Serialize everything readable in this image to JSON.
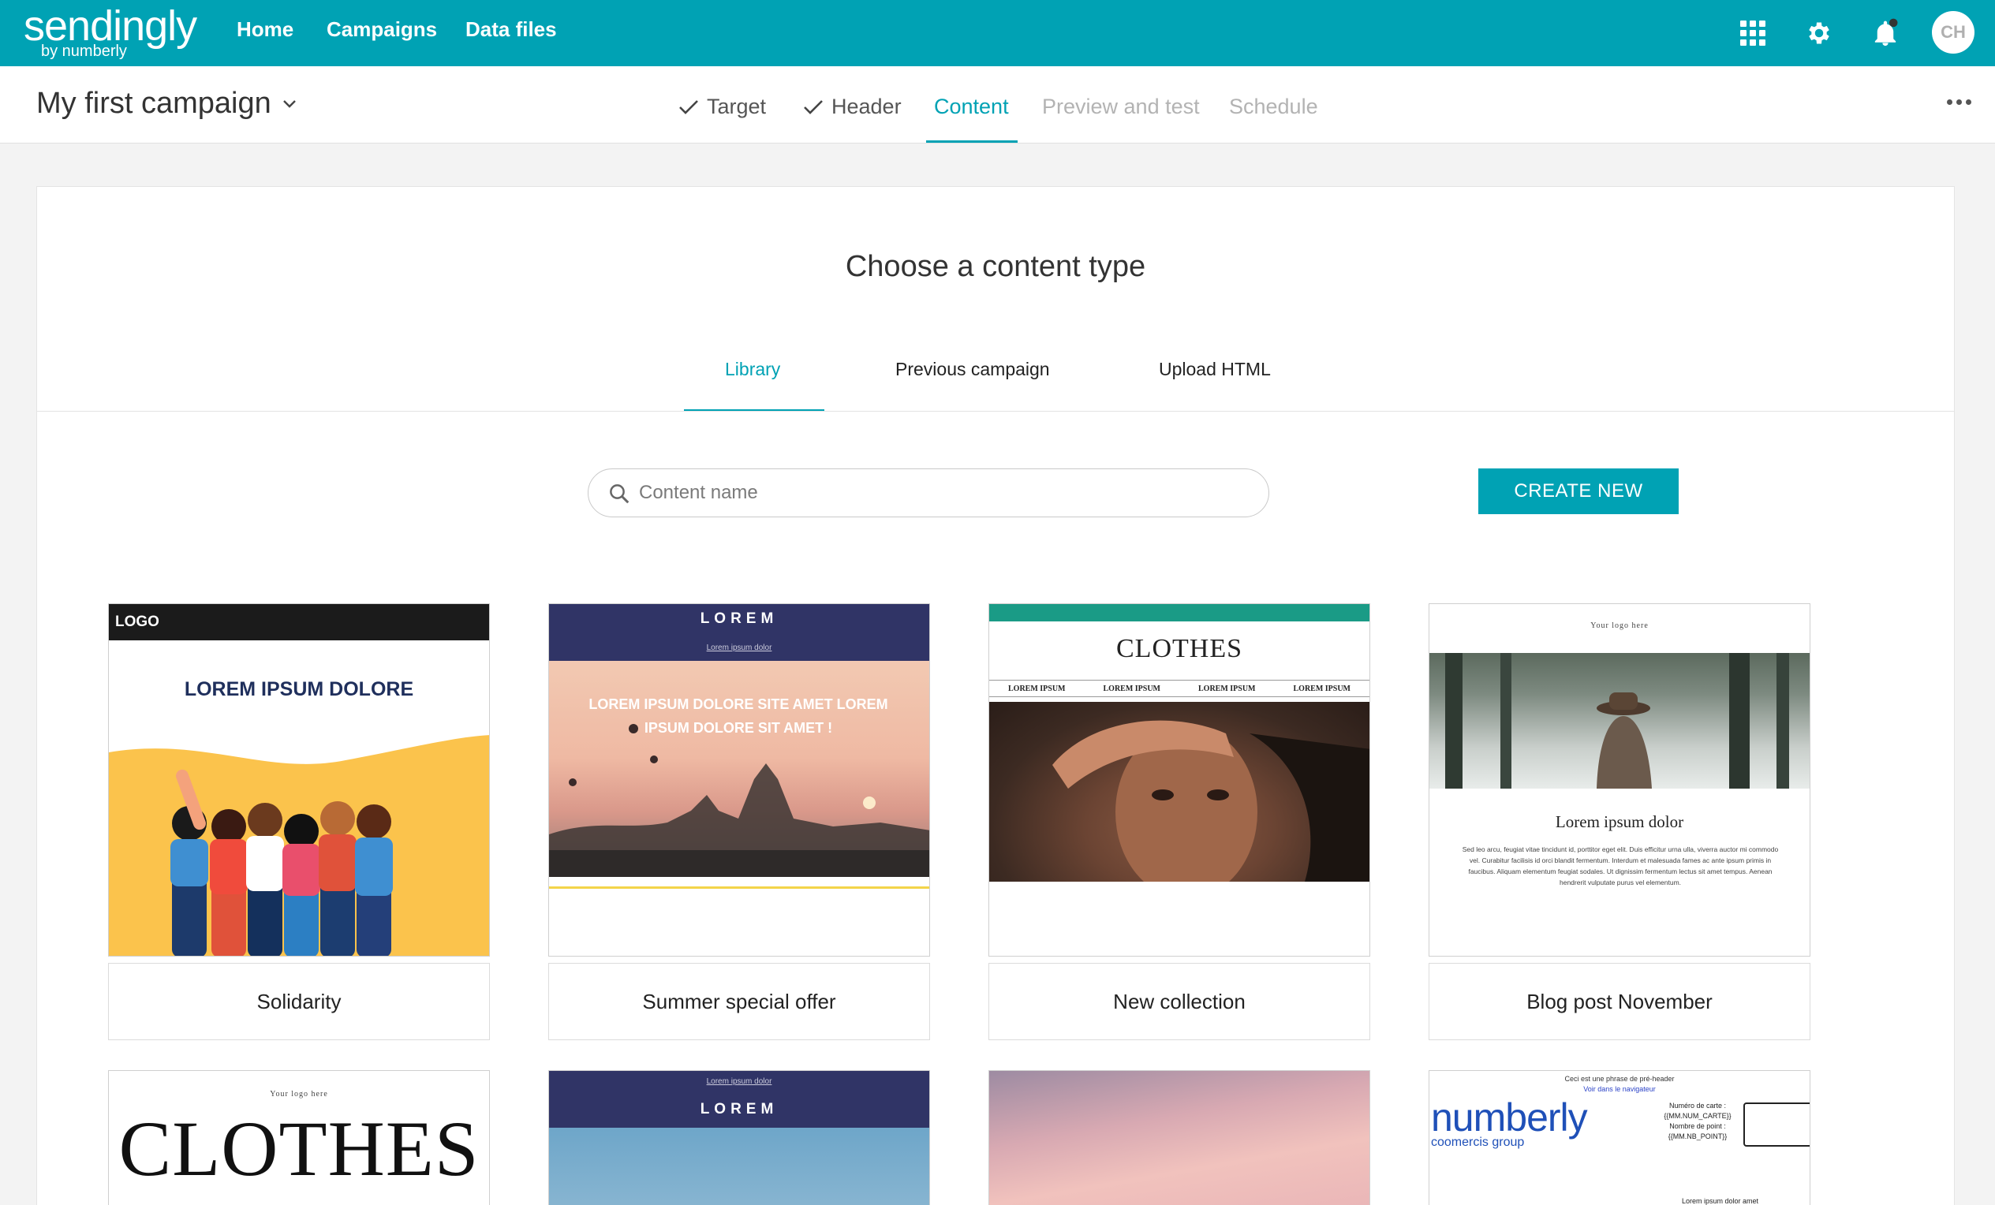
{
  "topnav": {
    "brand": "sendingly",
    "brand_sub": "by numberly",
    "links": [
      "Home",
      "Campaigns",
      "Data files"
    ],
    "avatar_initials": "CH"
  },
  "campaign": {
    "title": "My first campaign",
    "steps": [
      {
        "label": "Target",
        "state": "done"
      },
      {
        "label": "Header",
        "state": "done"
      },
      {
        "label": "Content",
        "state": "active"
      },
      {
        "label": "Preview and test",
        "state": "disabled"
      },
      {
        "label": "Schedule",
        "state": "disabled"
      }
    ]
  },
  "content": {
    "title": "Choose a content type",
    "tabs": [
      "Library",
      "Previous campaign",
      "Upload HTML"
    ],
    "search_placeholder": "Content name",
    "create_label": "CREATE NEW"
  },
  "templates": [
    {
      "name": "Solidarity",
      "logo": "LOGO",
      "headline": "LOREM IPSUM DOLORE"
    },
    {
      "name": "Summer special offer",
      "brand": "LOREM",
      "sub": "Lorem ipsum dolor",
      "headline": "LOREM IPSUM DOLORE SITE AMET LOREM IPSUM DOLORE SIT AMET !"
    },
    {
      "name": "New collection",
      "brand": "CLOTHES",
      "nav": [
        "LOREM IPSUM",
        "LOREM IPSUM",
        "LOREM IPSUM",
        "LOREM IPSUM"
      ]
    },
    {
      "name": "Blog post November",
      "logo": "Your logo here",
      "headline": "Lorem ipsum dolor",
      "body": "Sed leo arcu, feugiat vitae tincidunt id, porttitor eget elit. Duis efficitur urna ulla, viverra auctor mi commodo vel. Curabitur facilisis id orci blandit fermentum. Interdum et malesuada fames ac ante ipsum primis in faucibus. Aliquam elementum feugiat sodales. Ut dignissim fermentum lectus sit amet tempus. Aenean hendrerit vulputate purus vel elementum."
    }
  ],
  "templates_row2": [
    {
      "logo": "Your logo here",
      "brand": "CLOTHES"
    },
    {
      "sub": "Lorem ipsum dolor",
      "brand": "LOREM"
    },
    {},
    {
      "preheader": "Ceci est une phrase de pré-header",
      "link": "Voir dans le navigateur",
      "logo": "numberly",
      "group": "coomercis group",
      "card_lines": [
        "Numéro de carte :",
        "{{MM.NUM_CARTE}}",
        "Nombre de point :",
        "{{MM.NB_POINT}}"
      ],
      "footer": "Lorem ipsum dolor amet"
    }
  ],
  "colors": {
    "accent": "#00a2b4",
    "navy": "#303466"
  }
}
